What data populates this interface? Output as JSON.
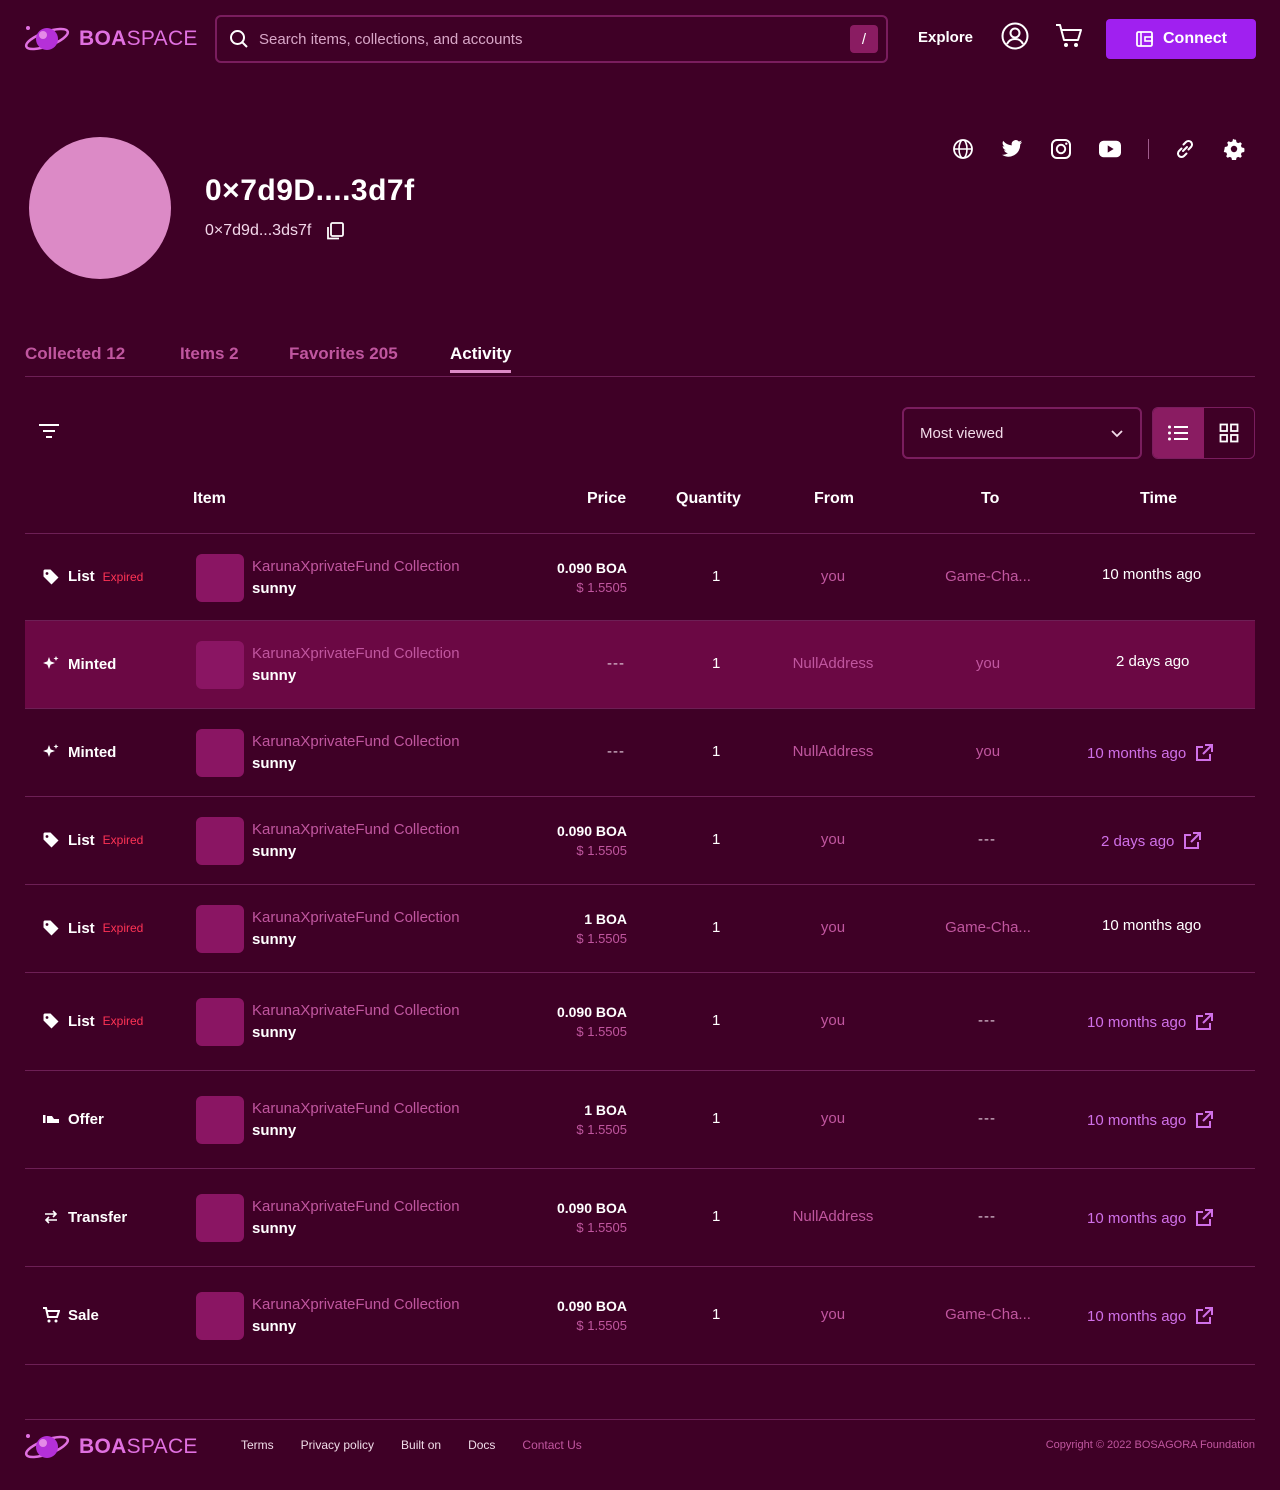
{
  "header": {
    "logo_bold": "BOA",
    "logo_rest": "SPACE",
    "search_placeholder": "Search items, collections, and accounts",
    "search_shortcut": "/",
    "explore": "Explore",
    "connect": "Connect"
  },
  "profile": {
    "name": "0×7d9D....3d7f",
    "address": "0×7d9d...3ds7f",
    "avatar_color": "#dc8ac6"
  },
  "tabs": [
    {
      "label": "Collected  12"
    },
    {
      "label": "Items 2"
    },
    {
      "label": "Favorites 205"
    },
    {
      "label": "Activity"
    }
  ],
  "sort": {
    "selected": "Most viewed"
  },
  "table": {
    "headers": {
      "item": "Item",
      "price": "Price",
      "quantity": "Quantity",
      "from": "From",
      "to": "To",
      "time": "Time"
    },
    "rows": [
      {
        "event": "List",
        "badge": "Expired",
        "icon": "tag-icon",
        "collection": "KarunaXprivateFund Collection",
        "name": "sunny",
        "price": "0.090 BOA",
        "usd": "$ 1.5505",
        "qty": "1",
        "from": "you",
        "to": "Game-Cha...",
        "time": "10 months ago",
        "time_link": false
      },
      {
        "event": "Minted",
        "badge": "",
        "icon": "sparkle-icon",
        "collection": "KarunaXprivateFund Collection",
        "name": "sunny",
        "price": "---",
        "usd": "",
        "qty": "1",
        "from": "NullAddress",
        "to": "you",
        "time": "2 days ago",
        "time_link": false
      },
      {
        "event": "Minted",
        "badge": "",
        "icon": "sparkle-icon",
        "collection": "KarunaXprivateFund Collection",
        "name": "sunny",
        "price": "---",
        "usd": "",
        "qty": "1",
        "from": "NullAddress",
        "to": "you",
        "time": "10 months ago",
        "time_link": true
      },
      {
        "event": "List",
        "badge": "Expired",
        "icon": "tag-icon",
        "collection": "KarunaXprivateFund Collection",
        "name": "sunny",
        "price": "0.090 BOA",
        "usd": "$ 1.5505",
        "qty": "1",
        "from": "you",
        "to": "---",
        "time": "2 days ago",
        "time_link": true
      },
      {
        "event": "List",
        "badge": "Expired",
        "icon": "tag-icon",
        "collection": "KarunaXprivateFund Collection",
        "name": "sunny",
        "price": "1 BOA",
        "usd": "$ 1.5505",
        "qty": "1",
        "from": "you",
        "to": "Game-Cha...",
        "time": "10 months ago",
        "time_link": false
      },
      {
        "event": "List",
        "badge": "Expired",
        "icon": "tag-icon",
        "collection": "KarunaXprivateFund Collection",
        "name": "sunny",
        "price": "0.090 BOA",
        "usd": "$ 1.5505",
        "qty": "1",
        "from": "you",
        "to": "---",
        "time": "10 months ago",
        "time_link": true
      },
      {
        "event": "Offer",
        "badge": "",
        "icon": "offer-icon",
        "collection": "KarunaXprivateFund Collection",
        "name": "sunny",
        "price": "1 BOA",
        "usd": "$ 1.5505",
        "qty": "1",
        "from": "you",
        "to": "---",
        "time": "10 months ago",
        "time_link": true
      },
      {
        "event": "Transfer",
        "badge": "",
        "icon": "transfer-icon",
        "collection": "KarunaXprivateFund Collection",
        "name": "sunny",
        "price": "0.090 BOA",
        "usd": "$ 1.5505",
        "qty": "1",
        "from": "NullAddress",
        "to": "---",
        "time": "10 months ago",
        "time_link": true
      },
      {
        "event": "Sale",
        "badge": "",
        "icon": "cart-icon",
        "collection": "KarunaXprivateFund Collection",
        "name": "sunny",
        "price": "0.090 BOA",
        "usd": "$ 1.5505",
        "qty": "1",
        "from": "you",
        "to": "Game-Cha...",
        "time": "10 months ago",
        "time_link": true
      }
    ]
  },
  "footer": {
    "links": [
      "Terms",
      "Privacy policy",
      "Built on",
      "Docs",
      "Contact Us"
    ],
    "copyright": "Copyright © 2022 BOSAGORA Foundation"
  },
  "colors": {
    "background": "#3f0026",
    "accent": "#a020f0",
    "pink": "#c0569f",
    "highlight_row": "#6b0844",
    "expired": "#ff3355"
  }
}
